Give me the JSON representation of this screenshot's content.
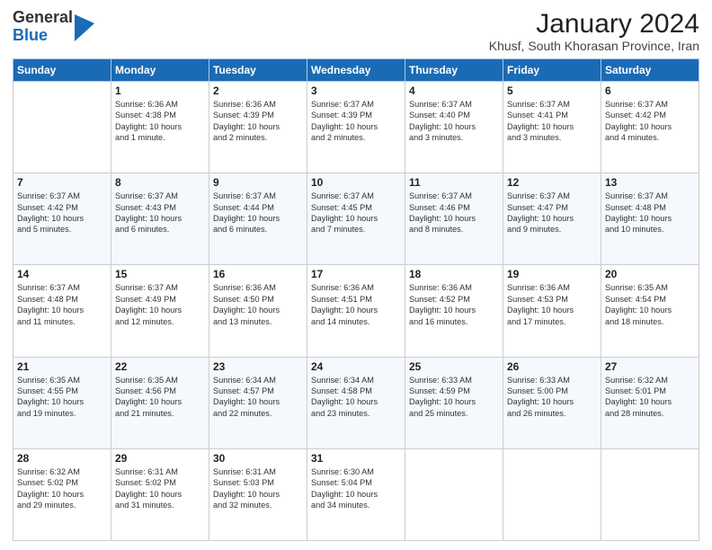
{
  "header": {
    "logo_general": "General",
    "logo_blue": "Blue",
    "title": "January 2024",
    "subtitle": "Khusf, South Khorasan Province, Iran"
  },
  "days_of_week": [
    "Sunday",
    "Monday",
    "Tuesday",
    "Wednesday",
    "Thursday",
    "Friday",
    "Saturday"
  ],
  "weeks": [
    [
      {
        "day": "",
        "info": ""
      },
      {
        "day": "1",
        "info": "Sunrise: 6:36 AM\nSunset: 4:38 PM\nDaylight: 10 hours\nand 1 minute."
      },
      {
        "day": "2",
        "info": "Sunrise: 6:36 AM\nSunset: 4:39 PM\nDaylight: 10 hours\nand 2 minutes."
      },
      {
        "day": "3",
        "info": "Sunrise: 6:37 AM\nSunset: 4:39 PM\nDaylight: 10 hours\nand 2 minutes."
      },
      {
        "day": "4",
        "info": "Sunrise: 6:37 AM\nSunset: 4:40 PM\nDaylight: 10 hours\nand 3 minutes."
      },
      {
        "day": "5",
        "info": "Sunrise: 6:37 AM\nSunset: 4:41 PM\nDaylight: 10 hours\nand 3 minutes."
      },
      {
        "day": "6",
        "info": "Sunrise: 6:37 AM\nSunset: 4:42 PM\nDaylight: 10 hours\nand 4 minutes."
      }
    ],
    [
      {
        "day": "7",
        "info": "Sunrise: 6:37 AM\nSunset: 4:42 PM\nDaylight: 10 hours\nand 5 minutes."
      },
      {
        "day": "8",
        "info": "Sunrise: 6:37 AM\nSunset: 4:43 PM\nDaylight: 10 hours\nand 6 minutes."
      },
      {
        "day": "9",
        "info": "Sunrise: 6:37 AM\nSunset: 4:44 PM\nDaylight: 10 hours\nand 6 minutes."
      },
      {
        "day": "10",
        "info": "Sunrise: 6:37 AM\nSunset: 4:45 PM\nDaylight: 10 hours\nand 7 minutes."
      },
      {
        "day": "11",
        "info": "Sunrise: 6:37 AM\nSunset: 4:46 PM\nDaylight: 10 hours\nand 8 minutes."
      },
      {
        "day": "12",
        "info": "Sunrise: 6:37 AM\nSunset: 4:47 PM\nDaylight: 10 hours\nand 9 minutes."
      },
      {
        "day": "13",
        "info": "Sunrise: 6:37 AM\nSunset: 4:48 PM\nDaylight: 10 hours\nand 10 minutes."
      }
    ],
    [
      {
        "day": "14",
        "info": "Sunrise: 6:37 AM\nSunset: 4:48 PM\nDaylight: 10 hours\nand 11 minutes."
      },
      {
        "day": "15",
        "info": "Sunrise: 6:37 AM\nSunset: 4:49 PM\nDaylight: 10 hours\nand 12 minutes."
      },
      {
        "day": "16",
        "info": "Sunrise: 6:36 AM\nSunset: 4:50 PM\nDaylight: 10 hours\nand 13 minutes."
      },
      {
        "day": "17",
        "info": "Sunrise: 6:36 AM\nSunset: 4:51 PM\nDaylight: 10 hours\nand 14 minutes."
      },
      {
        "day": "18",
        "info": "Sunrise: 6:36 AM\nSunset: 4:52 PM\nDaylight: 10 hours\nand 16 minutes."
      },
      {
        "day": "19",
        "info": "Sunrise: 6:36 AM\nSunset: 4:53 PM\nDaylight: 10 hours\nand 17 minutes."
      },
      {
        "day": "20",
        "info": "Sunrise: 6:35 AM\nSunset: 4:54 PM\nDaylight: 10 hours\nand 18 minutes."
      }
    ],
    [
      {
        "day": "21",
        "info": "Sunrise: 6:35 AM\nSunset: 4:55 PM\nDaylight: 10 hours\nand 19 minutes."
      },
      {
        "day": "22",
        "info": "Sunrise: 6:35 AM\nSunset: 4:56 PM\nDaylight: 10 hours\nand 21 minutes."
      },
      {
        "day": "23",
        "info": "Sunrise: 6:34 AM\nSunset: 4:57 PM\nDaylight: 10 hours\nand 22 minutes."
      },
      {
        "day": "24",
        "info": "Sunrise: 6:34 AM\nSunset: 4:58 PM\nDaylight: 10 hours\nand 23 minutes."
      },
      {
        "day": "25",
        "info": "Sunrise: 6:33 AM\nSunset: 4:59 PM\nDaylight: 10 hours\nand 25 minutes."
      },
      {
        "day": "26",
        "info": "Sunrise: 6:33 AM\nSunset: 5:00 PM\nDaylight: 10 hours\nand 26 minutes."
      },
      {
        "day": "27",
        "info": "Sunrise: 6:32 AM\nSunset: 5:01 PM\nDaylight: 10 hours\nand 28 minutes."
      }
    ],
    [
      {
        "day": "28",
        "info": "Sunrise: 6:32 AM\nSunset: 5:02 PM\nDaylight: 10 hours\nand 29 minutes."
      },
      {
        "day": "29",
        "info": "Sunrise: 6:31 AM\nSunset: 5:02 PM\nDaylight: 10 hours\nand 31 minutes."
      },
      {
        "day": "30",
        "info": "Sunrise: 6:31 AM\nSunset: 5:03 PM\nDaylight: 10 hours\nand 32 minutes."
      },
      {
        "day": "31",
        "info": "Sunrise: 6:30 AM\nSunset: 5:04 PM\nDaylight: 10 hours\nand 34 minutes."
      },
      {
        "day": "",
        "info": ""
      },
      {
        "day": "",
        "info": ""
      },
      {
        "day": "",
        "info": ""
      }
    ]
  ]
}
